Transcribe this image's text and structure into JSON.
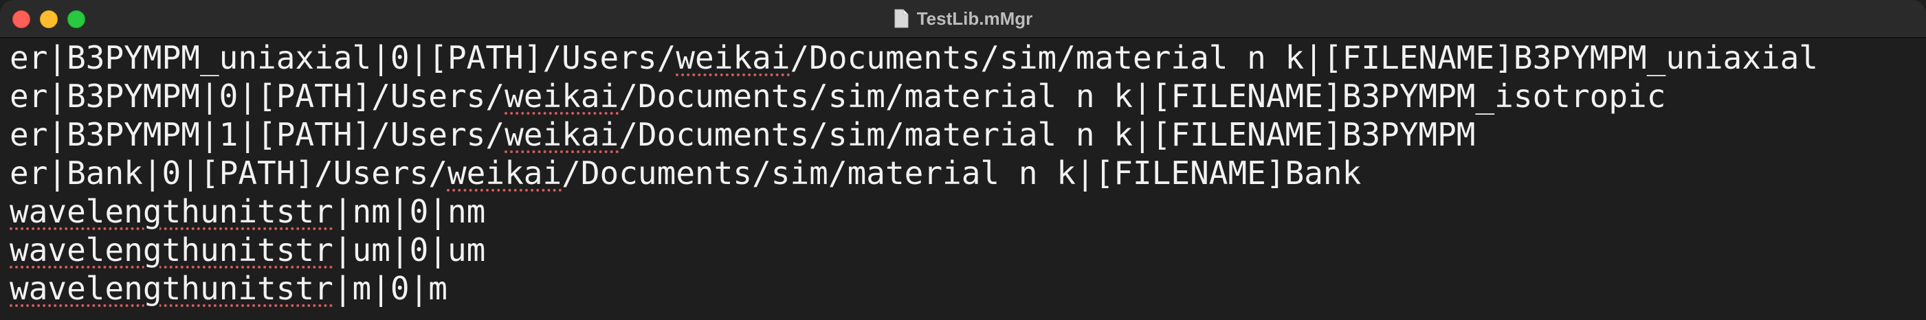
{
  "window": {
    "title": "TestLib.mMgr",
    "file_icon": "document-icon"
  },
  "traffic_lights": {
    "close_color": "#ff5f57",
    "minimize_color": "#febc2e",
    "maximize_color": "#28c840"
  },
  "editor": {
    "lines": [
      [
        {
          "text": "er|B3PYMPM_uniaxial|0|[PATH]/Users/"
        },
        {
          "text": "weikai",
          "spell": true
        },
        {
          "text": "/Documents/sim/material n k|[FILENAME]B3PYMPM_uniaxial"
        }
      ],
      [
        {
          "text": "er|B3PYMPM|0|[PATH]/Users/"
        },
        {
          "text": "weikai",
          "spell": true
        },
        {
          "text": "/Documents/sim/material n k|[FILENAME]B3PYMPM_isotropic"
        }
      ],
      [
        {
          "text": "er|B3PYMPM|1|[PATH]/Users/"
        },
        {
          "text": "weikai",
          "spell": true
        },
        {
          "text": "/Documents/sim/material n k|[FILENAME]B3PYMPM"
        }
      ],
      [
        {
          "text": "er|Bank|0|[PATH]/Users/"
        },
        {
          "text": "weikai",
          "spell": true
        },
        {
          "text": "/Documents/sim/material n k|[FILENAME]Bank"
        }
      ],
      [
        {
          "text": "wavelengthunitstr",
          "spell": true
        },
        {
          "text": "|nm|0|nm"
        }
      ],
      [
        {
          "text": "wavelengthunitstr",
          "spell": true
        },
        {
          "text": "|um|0|um"
        }
      ],
      [
        {
          "text": "wavelengthunitstr",
          "spell": true
        },
        {
          "text": "|m|0|m"
        }
      ]
    ],
    "spellcheck_color": "#d05a5a",
    "text_color": "#f2f2f2",
    "background": "#1e1e1e"
  }
}
